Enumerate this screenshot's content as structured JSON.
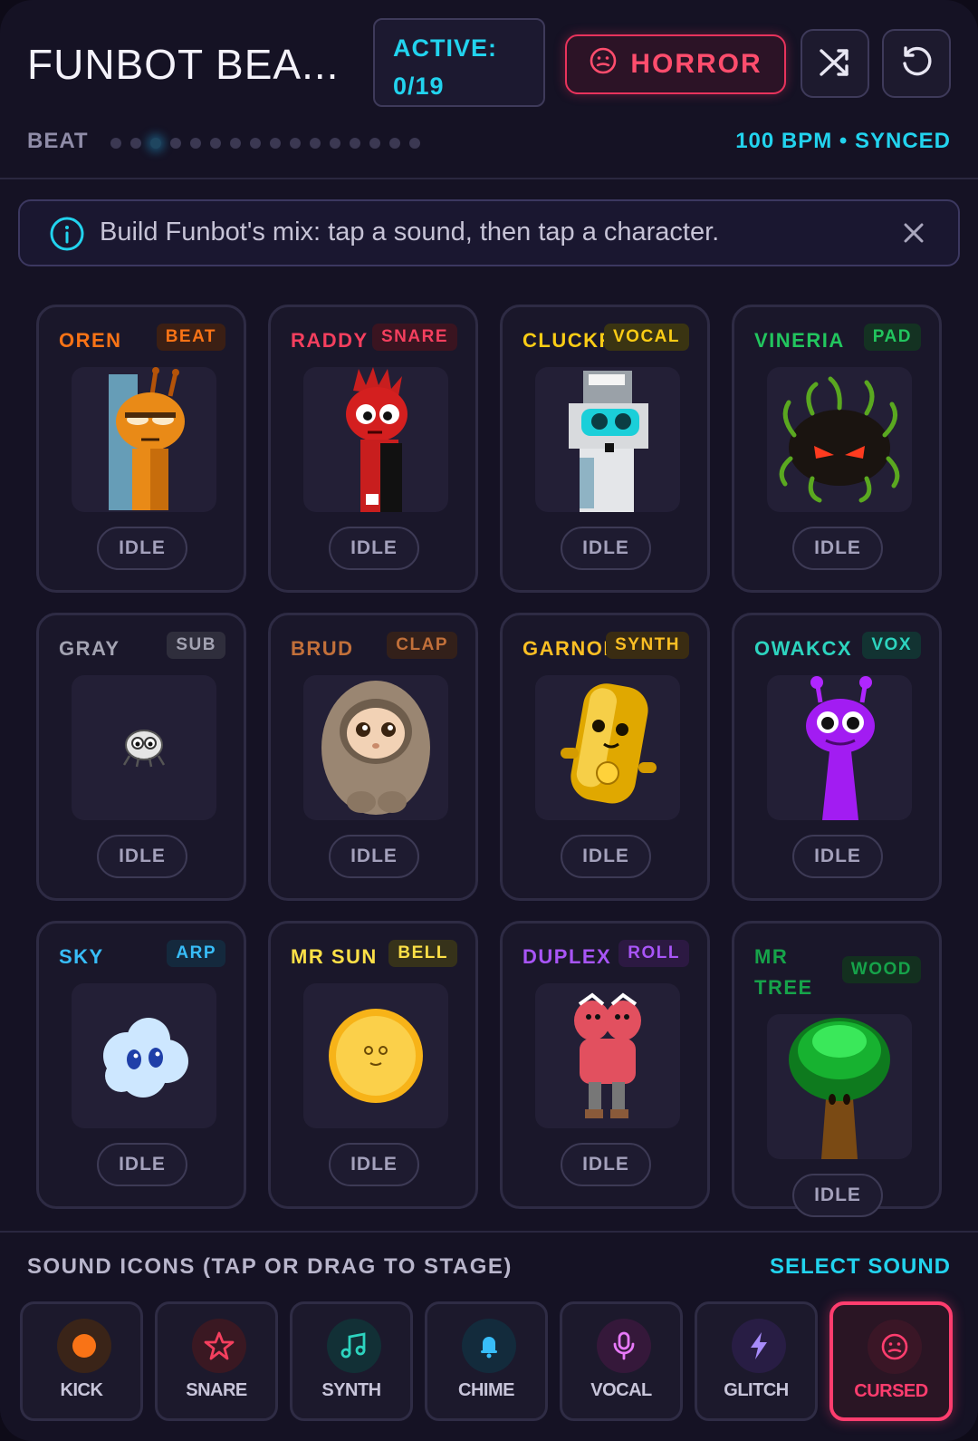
{
  "header": {
    "title": "FUNBOT BEA...",
    "active_label": "ACTIVE:",
    "active_count": "0/19",
    "mode_button": "HORROR",
    "shuffle_icon": "shuffle-icon",
    "reset_icon": "reset-icon"
  },
  "beat": {
    "label": "BEAT",
    "dot_count": 16,
    "active_dot": 3,
    "status": "100 BPM • SYNCED"
  },
  "banner": {
    "icon": "info-icon",
    "text": "Build Funbot's mix: tap a sound, then tap a character.",
    "close_icon": "close-icon"
  },
  "characters": [
    {
      "name": "OREN",
      "tag": "BEAT",
      "status": "IDLE",
      "color": "#f97316",
      "tag_bg": "#3b1f14",
      "art": "oren"
    },
    {
      "name": "RADDY",
      "tag": "SNARE",
      "status": "IDLE",
      "color": "#f43f5e",
      "tag_bg": "#3a1420",
      "art": "raddy"
    },
    {
      "name": "CLUCKR",
      "tag": "VOCAL",
      "status": "IDLE",
      "color": "#facc15",
      "tag_bg": "#3a3412",
      "art": "cluckr"
    },
    {
      "name": "VINERIA",
      "tag": "PAD",
      "status": "IDLE",
      "color": "#22c55e",
      "tag_bg": "#143222",
      "art": "vineria"
    },
    {
      "name": "GRAY",
      "tag": "SUB",
      "status": "IDLE",
      "color": "#a3a3b2",
      "tag_bg": "#2f2e3c",
      "art": "gray"
    },
    {
      "name": "BRUD",
      "tag": "CLAP",
      "status": "IDLE",
      "color": "#c2703a",
      "tag_bg": "#33201a",
      "art": "brud"
    },
    {
      "name": "GARNOLD",
      "tag": "SYNTH",
      "status": "IDLE",
      "color": "#fbbf24",
      "tag_bg": "#3a2c12",
      "art": "garnold"
    },
    {
      "name": "OWAKCX",
      "tag": "VOX",
      "status": "IDLE",
      "color": "#2dd4bf",
      "tag_bg": "#123332",
      "art": "owakcx"
    },
    {
      "name": "SKY",
      "tag": "ARP",
      "status": "IDLE",
      "color": "#38bdf8",
      "tag_bg": "#14293d",
      "art": "sky"
    },
    {
      "name": "MR SUN",
      "tag": "BELL",
      "status": "IDLE",
      "color": "#fde047",
      "tag_bg": "#36321a",
      "art": "sun"
    },
    {
      "name": "DUPLEX",
      "tag": "ROLL",
      "status": "IDLE",
      "color": "#a855f7",
      "tag_bg": "#2c1942",
      "art": "duplex"
    },
    {
      "name": "MR TREE",
      "tag": "WOOD",
      "status": "IDLE",
      "color": "#16a34a",
      "tag_bg": "#13301f",
      "art": "tree"
    }
  ],
  "tray": {
    "title": "SOUND ICONS (TAP OR DRAG TO STAGE)",
    "action": "SELECT SOUND",
    "sounds": [
      {
        "label": "KICK",
        "icon": "kick-dot-icon",
        "bg": "#3a2418"
      },
      {
        "label": "SNARE",
        "icon": "star-icon",
        "bg": "#3a1822"
      },
      {
        "label": "SYNTH",
        "icon": "music-note-icon",
        "bg": "#123036"
      },
      {
        "label": "CHIME",
        "icon": "bell-icon",
        "bg": "#132b3c"
      },
      {
        "label": "VOCAL",
        "icon": "microphone-icon",
        "bg": "#35183a"
      },
      {
        "label": "GLITCH",
        "icon": "lightning-icon",
        "bg": "#281d44"
      },
      {
        "label": "CURSED",
        "icon": "cursed-face-icon",
        "bg": "#3a1626",
        "selected": true
      }
    ]
  }
}
